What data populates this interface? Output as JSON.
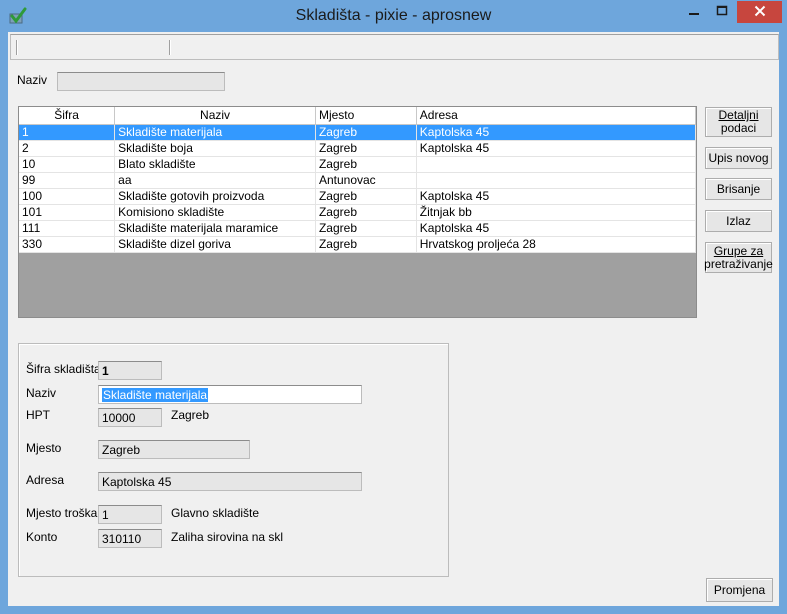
{
  "window": {
    "title": "Skladišta - pixie - aprosnew"
  },
  "filter": {
    "naziv_label": "Naziv",
    "naziv_value": ""
  },
  "grid": {
    "columns": [
      "Šifra",
      "Naziv",
      "Mjesto",
      "Adresa"
    ],
    "rows": [
      {
        "sifra": "1",
        "naziv": "Skladište materijala",
        "mjesto": "Zagreb",
        "adresa": "Kaptolska 45"
      },
      {
        "sifra": "2",
        "naziv": "Skladište boja",
        "mjesto": "Zagreb",
        "adresa": "Kaptolska 45"
      },
      {
        "sifra": "10",
        "naziv": "Blato skladište",
        "mjesto": "Zagreb",
        "adresa": ""
      },
      {
        "sifra": "99",
        "naziv": "aa",
        "mjesto": "Antunovac",
        "adresa": ""
      },
      {
        "sifra": "100",
        "naziv": "Skladište gotovih proizvoda",
        "mjesto": "Zagreb",
        "adresa": "Kaptolska 45"
      },
      {
        "sifra": "101",
        "naziv": "Komisiono skladište",
        "mjesto": "Zagreb",
        "adresa": "Žitnjak bb"
      },
      {
        "sifra": "111",
        "naziv": "Skladište materijala maramice",
        "mjesto": "Zagreb",
        "adresa": "Kaptolska 45"
      },
      {
        "sifra": "330",
        "naziv": "Skladište dizel goriva",
        "mjesto": "Zagreb",
        "adresa": "Hrvatskog proljeća 28"
      }
    ],
    "selected_index": 0
  },
  "buttons": {
    "detalji_line1": "Detaljni",
    "detalji_line2": "podaci",
    "upis_novog": "Upis novog",
    "brisanje": "Brisanje",
    "izlaz": "Izlaz",
    "grupe_line1": "Grupe za",
    "grupe_line2": "pretraživanje",
    "promjena": "Promjena"
  },
  "detail": {
    "sifra_label": "Šifra skladišta",
    "sifra_value": "1",
    "naziv_label": "Naziv",
    "naziv_value": "Skladište materijala",
    "hpt_label": "HPT",
    "hpt_value": "10000",
    "hpt_city": "Zagreb",
    "mjesto_label": "Mjesto",
    "mjesto_value": "Zagreb",
    "adresa_label": "Adresa",
    "adresa_value": "Kaptolska 45",
    "mjesto_troska_label": "Mjesto troška",
    "mjesto_troska_value": "1",
    "mjesto_troska_name": "Glavno skladište",
    "konto_label": "Konto",
    "konto_value": "310110",
    "konto_name": "Zaliha sirovina na skl"
  },
  "colors": {
    "titlebar": "#6ea6dc",
    "selection": "#3399ff",
    "close": "#c7463e"
  },
  "icons": {
    "app": "checkmark-app-icon",
    "minimize": "minimize-icon",
    "maximize": "maximize-icon",
    "close": "close-icon"
  }
}
